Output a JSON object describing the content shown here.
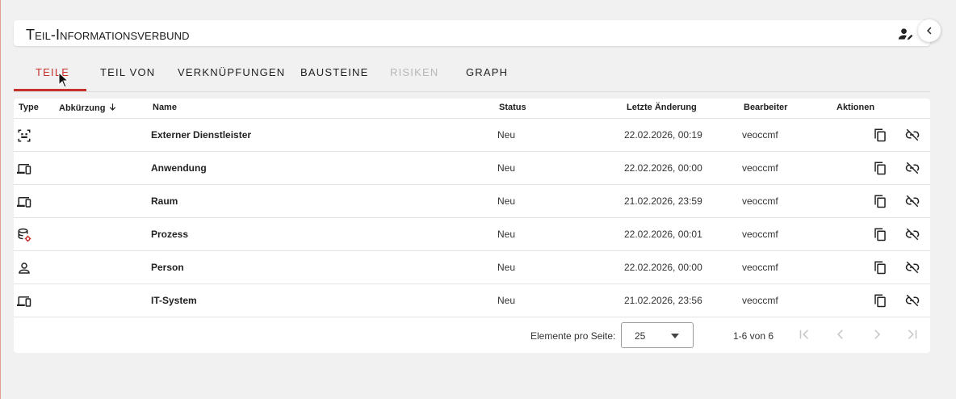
{
  "header": {
    "title": "Teil-Informationsverbund",
    "user_icon": "person-edit-icon",
    "collapse_icon": "chevron-left-icon"
  },
  "tabs": [
    {
      "label": "Teile",
      "state": "active"
    },
    {
      "label": "Teil von",
      "state": "normal"
    },
    {
      "label": "Verknüpfungen",
      "state": "normal"
    },
    {
      "label": "Bausteine",
      "state": "normal"
    },
    {
      "label": "Risiken",
      "state": "disabled"
    },
    {
      "label": "Graph",
      "state": "normal"
    }
  ],
  "table": {
    "columns": {
      "type": "Type",
      "abbreviation": "Abkürzung",
      "name": "Name",
      "status": "Status",
      "last_change": "Letzte Änderung",
      "editor": "Bearbeiter",
      "actions": "Aktionen"
    },
    "sort_icon": "arrow-down-icon",
    "rows": [
      {
        "type_icon": "scope-icon",
        "abbreviation": "",
        "name": "Externer Dienstleister",
        "status": "Neu",
        "last_change": "22.02.2026, 00:19",
        "editor": "veoccmf"
      },
      {
        "type_icon": "devices-icon",
        "abbreviation": "",
        "name": "Anwendung",
        "status": "Neu",
        "last_change": "22.02.2026, 00:00",
        "editor": "veoccmf"
      },
      {
        "type_icon": "devices-icon",
        "abbreviation": "",
        "name": "Raum",
        "status": "Neu",
        "last_change": "21.02.2026, 23:59",
        "editor": "veoccmf"
      },
      {
        "type_icon": "database-settings-icon",
        "abbreviation": "",
        "name": "Prozess",
        "status": "Neu",
        "last_change": "22.02.2026, 00:01",
        "editor": "veoccmf"
      },
      {
        "type_icon": "person-icon",
        "abbreviation": "",
        "name": "Person",
        "status": "Neu",
        "last_change": "22.02.2026, 00:00",
        "editor": "veoccmf"
      },
      {
        "type_icon": "devices-icon",
        "abbreviation": "",
        "name": "IT-System",
        "status": "Neu",
        "last_change": "21.02.2026, 23:56",
        "editor": "veoccmf"
      }
    ],
    "row_action_icons": [
      "copy-icon",
      "unlink-icon"
    ]
  },
  "pagination": {
    "per_page_label": "Elemente pro Seite:",
    "per_page_value": "25",
    "range": "1-6 von 6"
  },
  "colors": {
    "accent": "#c8302c",
    "background": "#f2f1f1",
    "disabled": "#b8b8b8"
  }
}
